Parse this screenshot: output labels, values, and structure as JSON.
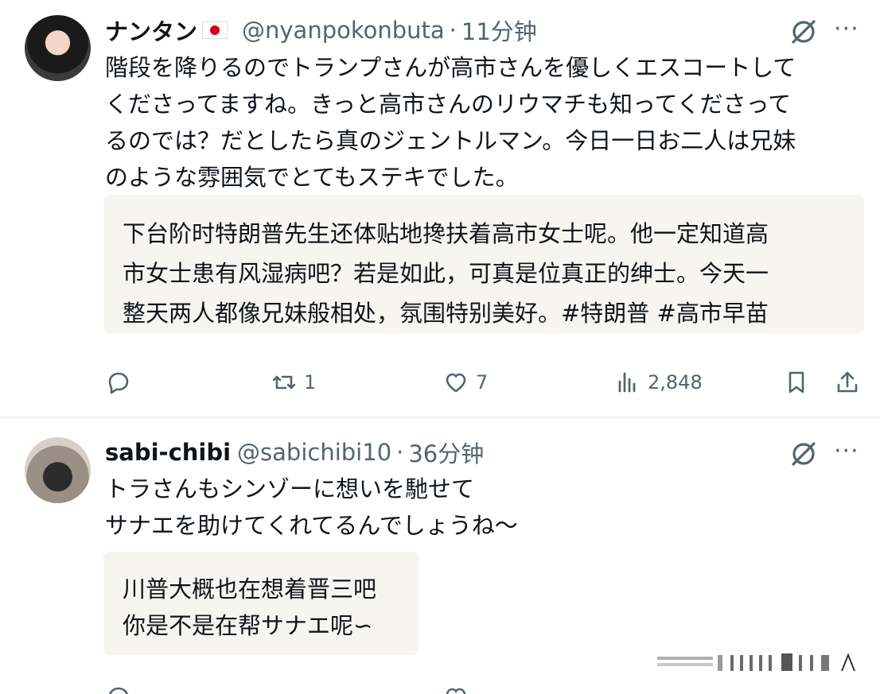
{
  "posts": [
    {
      "name": "ナンタン",
      "handle": "@nyanpokonbuta",
      "separator": "·",
      "time": "11分钟",
      "text": "階段を降りるのでトランプさんが高市さんを優しくエスコートして\nくださってますね。きっと高市さんのリウマチも知ってくださって\nるのでは？だとしたら真のジェントルマン。今日一日お二人は兄妹\nのような雰囲気でとてもステキでした。",
      "translation": "下台阶时特朗普先生还体贴地搀扶着高市女士呢。他一定知道高\n市女士患有风湿病吧？若是如此，可真是位真正的绅士。今天一\n整天两人都像兄妹般相处，氛围特别美好。#特朗普 #高市早苗",
      "actions": {
        "reply_icon": "reply-icon",
        "repost_icon": "repost-icon",
        "repost_count": "1",
        "like_icon": "heart-icon",
        "like_count": "7",
        "views_icon": "views-icon",
        "views_count": "2,848",
        "bookmark_icon": "bookmark-icon",
        "share_icon": "share-icon"
      }
    },
    {
      "name": "sabi-chibi",
      "handle": "@sabichibi10",
      "separator": "·",
      "time": "36分钟",
      "text": "トラさんもシンゾーに想いを馳せて\nサナエを助けてくれてるんでしょうね〜",
      "translation": "川普大概也在想着晋三吧\n你是不是在帮サナエ呢∽"
    }
  ],
  "more_label": "···",
  "colors": {
    "text": "#0f1419",
    "secondary": "#536471",
    "translation_bg": "#f7f5f2",
    "divider": "#eff3f4"
  }
}
